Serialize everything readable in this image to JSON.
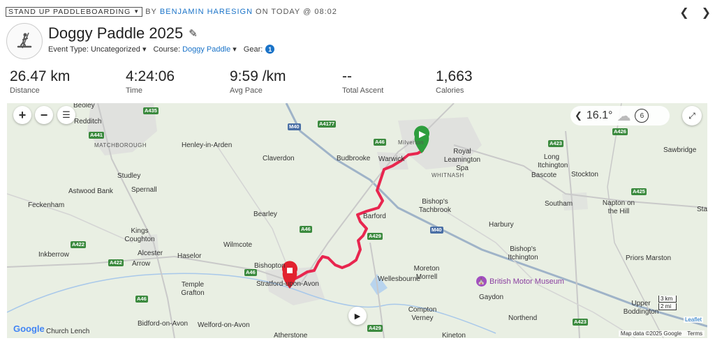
{
  "header": {
    "sport": "STAND UP PADDLEBOARDING",
    "by_text": "BY",
    "author": "BENJAMIN HARESIGN",
    "when": "ON TODAY @ 08:02",
    "title": "Doggy Paddle 2025",
    "event_type_label": "Event Type:",
    "event_type_value": "Uncategorized",
    "course_label": "Course:",
    "course_value": "Doggy Paddle",
    "gear_label": "Gear:",
    "gear_count": "1"
  },
  "stats": [
    {
      "value": "26.47 km",
      "label": "Distance"
    },
    {
      "value": "4:24:06",
      "label": "Time"
    },
    {
      "value": "9:59 /km",
      "label": "Avg Pace"
    },
    {
      "value": "--",
      "label": "Total Ascent"
    },
    {
      "value": "1,663",
      "label": "Calories"
    }
  ],
  "map": {
    "temperature": "16.1°",
    "weather_icon": "cloud-icon",
    "wind_value": "6",
    "scale_km": "3 km",
    "scale_mi": "2 mi",
    "leaflet": "Leaflet",
    "map_data": "Map data ©2025 Google",
    "terms": "Terms",
    "google": "Google",
    "museum": "British Motor Museum",
    "route_color": "#e8264f",
    "start_color": "#2e9e3e",
    "end_color": "#e2222f",
    "places": [
      {
        "name": "Redditch"
      },
      {
        "name": "MATCHBOROUGH"
      },
      {
        "name": "Studley"
      },
      {
        "name": "Spernall"
      },
      {
        "name": "Astwood Bank"
      },
      {
        "name": "Feckenham"
      },
      {
        "name": "Henley-in-Arden"
      },
      {
        "name": "Claverdon"
      },
      {
        "name": "Budbrooke"
      },
      {
        "name": "Warwick"
      },
      {
        "name": "Royal Leamington Spa"
      },
      {
        "name": "WHITNASH"
      },
      {
        "name": "Bishop's Tachbrook"
      },
      {
        "name": "Barford"
      },
      {
        "name": "Bearley"
      },
      {
        "name": "Kings Coughton"
      },
      {
        "name": "Alcester"
      },
      {
        "name": "Arrow"
      },
      {
        "name": "Inkberrow"
      },
      {
        "name": "Haselor"
      },
      {
        "name": "Wilmcote"
      },
      {
        "name": "Bishopton"
      },
      {
        "name": "Stratford-upon-Avon"
      },
      {
        "name": "Temple Grafton"
      },
      {
        "name": "Bidford-on-Avon"
      },
      {
        "name": "Welford-on-Avon"
      },
      {
        "name": "Church Lench"
      },
      {
        "name": "Atherstone"
      },
      {
        "name": "Wellesbourne"
      },
      {
        "name": "Moreton Morrell"
      },
      {
        "name": "Compton Verney"
      },
      {
        "name": "Kineton"
      },
      {
        "name": "Gaydon"
      },
      {
        "name": "Northend"
      },
      {
        "name": "Upper Boddington"
      },
      {
        "name": "Bishop's Itchington"
      },
      {
        "name": "Harbury"
      },
      {
        "name": "Southam"
      },
      {
        "name": "Napton on the Hill"
      },
      {
        "name": "Priors Marston"
      },
      {
        "name": "Long Itchington"
      },
      {
        "name": "Bascote"
      },
      {
        "name": "Stockton"
      },
      {
        "name": "Sawbridge"
      },
      {
        "name": "Beoley"
      },
      {
        "name": "Milverton"
      },
      {
        "name": "Sta"
      }
    ],
    "roads": [
      {
        "name": "A435"
      },
      {
        "name": "A441"
      },
      {
        "name": "M40"
      },
      {
        "name": "A4177"
      },
      {
        "name": "A46"
      },
      {
        "name": "A423"
      },
      {
        "name": "A426"
      },
      {
        "name": "A425"
      },
      {
        "name": "A429"
      },
      {
        "name": "A422"
      }
    ]
  }
}
